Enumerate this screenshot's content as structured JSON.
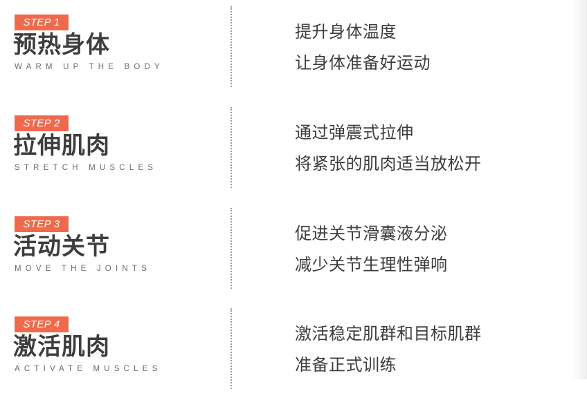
{
  "steps": [
    {
      "badge": "STEP 1",
      "title": "预热身体",
      "subtitle": "WARM UP THE BODY",
      "lines": [
        "提升身体温度",
        "让身体准备好运动"
      ]
    },
    {
      "badge": "STEP 2",
      "title": "拉伸肌肉",
      "subtitle": "STRETCH MUSCLES",
      "lines": [
        "通过弹震式拉伸",
        "将紧张的肌肉适当放松开"
      ]
    },
    {
      "badge": "STEP 3",
      "title": "活动关节",
      "subtitle": "MOVE THE JOINTS",
      "lines": [
        "促进关节滑囊液分泌",
        "减少关节生理性弹响"
      ]
    },
    {
      "badge": "STEP 4",
      "title": "激活肌肉",
      "subtitle": "ACTIVATE MUSCLES",
      "lines": [
        "激活稳定肌群和目标肌群",
        "准备正式训练"
      ]
    }
  ],
  "colors": {
    "badge": "#ef6a4c",
    "text": "#3d3d3d",
    "subtitle": "#6b6b6b",
    "divider": "#9a9a9a"
  }
}
